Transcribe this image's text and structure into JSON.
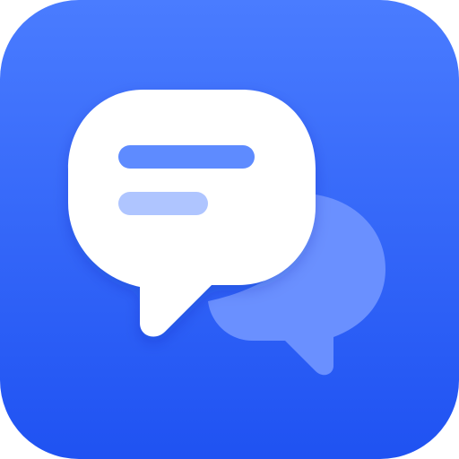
{
  "app_icon": {
    "icon_name": "chat-bubbles-icon",
    "colors": {
      "background_top": "#4A7CFF",
      "background_bottom": "#1F52F2",
      "front_bubble": "#FFFFFF",
      "back_bubble": "#6A90FF",
      "line_primary": "#5E8BFF",
      "line_secondary": "#AFC5FF"
    }
  }
}
